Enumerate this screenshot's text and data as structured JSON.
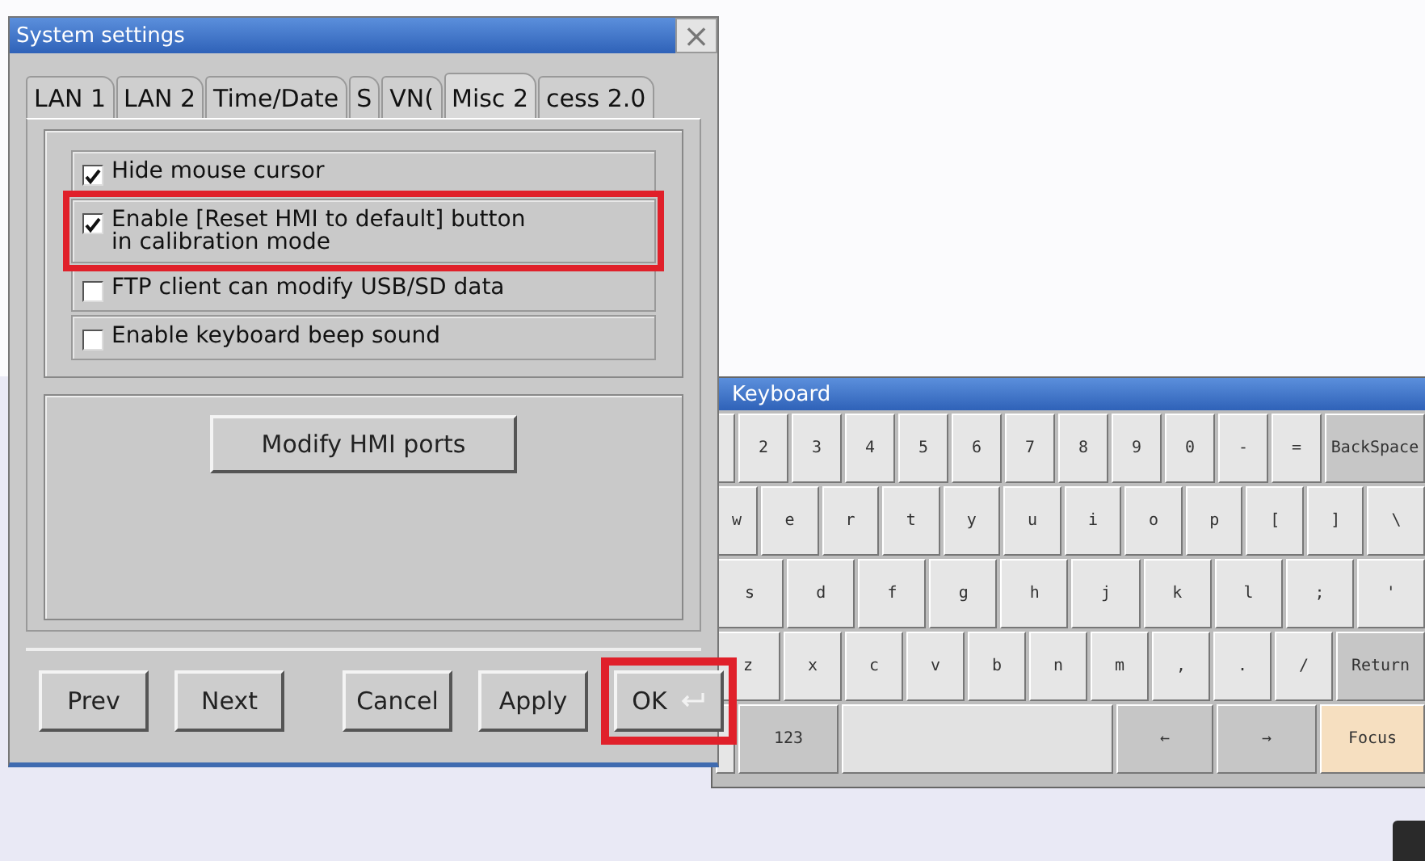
{
  "dialog": {
    "title": "System settings",
    "close": "×",
    "tabs": [
      {
        "label": "LAN 1",
        "selected": false
      },
      {
        "label": "LAN 2",
        "selected": false
      },
      {
        "label": "Time/Date",
        "selected": false
      },
      {
        "label": "S",
        "selected": false
      },
      {
        "label": "VN(",
        "selected": false
      },
      {
        "label": "Misc 2",
        "selected": true
      },
      {
        "label": "cess 2.0",
        "selected": false
      }
    ],
    "options": [
      {
        "label": "Hide mouse cursor",
        "checked": true,
        "highlighted": false
      },
      {
        "label": "Enable [Reset HMI to default] button\nin calibration mode",
        "checked": true,
        "highlighted": true
      },
      {
        "label": "FTP client can modify USB/SD data",
        "checked": false,
        "highlighted": false
      },
      {
        "label": "Enable keyboard beep sound",
        "checked": false,
        "highlighted": false
      }
    ],
    "ports_button": "Modify HMI ports",
    "buttons": [
      {
        "label": "Prev",
        "kind": "nav",
        "highlighted": false
      },
      {
        "label": "Next",
        "kind": "nav",
        "highlighted": false
      },
      {
        "label": "Cancel",
        "kind": "action",
        "highlighted": false
      },
      {
        "label": "Apply",
        "kind": "action",
        "highlighted": false
      },
      {
        "label": "OK",
        "kind": "confirm",
        "highlighted": true
      }
    ]
  },
  "keyboard": {
    "title": "Keyboard",
    "rows": [
      {
        "keys": [
          {
            "kind": "partial"
          },
          {
            "label": "2",
            "kind": "key"
          },
          {
            "label": "3",
            "kind": "key"
          },
          {
            "label": "4",
            "kind": "key"
          },
          {
            "label": "5",
            "kind": "key"
          },
          {
            "label": "6",
            "kind": "key"
          },
          {
            "label": "7",
            "kind": "key"
          },
          {
            "label": "8",
            "kind": "key"
          },
          {
            "label": "9",
            "kind": "key"
          },
          {
            "label": "0",
            "kind": "key"
          },
          {
            "label": "-",
            "kind": "key"
          },
          {
            "label": "=",
            "kind": "key"
          },
          {
            "label": "BackSpace",
            "kind": "function"
          }
        ]
      },
      {
        "keys": [
          {
            "label": "w",
            "kind": "partial"
          },
          {
            "label": "e",
            "kind": "key"
          },
          {
            "label": "r",
            "kind": "key"
          },
          {
            "label": "t",
            "kind": "key"
          },
          {
            "label": "y",
            "kind": "key"
          },
          {
            "label": "u",
            "kind": "key"
          },
          {
            "label": "i",
            "kind": "key"
          },
          {
            "label": "o",
            "kind": "key"
          },
          {
            "label": "p",
            "kind": "key"
          },
          {
            "label": "[",
            "kind": "key"
          },
          {
            "label": "]",
            "kind": "key"
          },
          {
            "label": "\\",
            "kind": "key"
          }
        ]
      },
      {
        "keys": [
          {
            "label": "s",
            "kind": "key"
          },
          {
            "label": "d",
            "kind": "key"
          },
          {
            "label": "f",
            "kind": "key"
          },
          {
            "label": "g",
            "kind": "key"
          },
          {
            "label": "h",
            "kind": "key"
          },
          {
            "label": "j",
            "kind": "key"
          },
          {
            "label": "k",
            "kind": "key"
          },
          {
            "label": "l",
            "kind": "key"
          },
          {
            "label": ";",
            "kind": "key"
          },
          {
            "label": "'",
            "kind": "key"
          }
        ]
      },
      {
        "keys": [
          {
            "label": "z",
            "kind": "key"
          },
          {
            "label": "x",
            "kind": "key"
          },
          {
            "label": "c",
            "kind": "key"
          },
          {
            "label": "v",
            "kind": "key"
          },
          {
            "label": "b",
            "kind": "key"
          },
          {
            "label": "n",
            "kind": "key"
          },
          {
            "label": "m",
            "kind": "key"
          },
          {
            "label": ",",
            "kind": "key"
          },
          {
            "label": ".",
            "kind": "key"
          },
          {
            "label": "/",
            "kind": "key"
          },
          {
            "label": "Return",
            "kind": "function"
          }
        ]
      },
      {
        "keys": [
          {
            "kind": "partial"
          },
          {
            "label": "123",
            "kind": "function"
          },
          {
            "kind": "space"
          },
          {
            "label": "←",
            "kind": "function"
          },
          {
            "label": "→",
            "kind": "function"
          },
          {
            "label": "Focus",
            "kind": "focus"
          }
        ]
      }
    ]
  }
}
